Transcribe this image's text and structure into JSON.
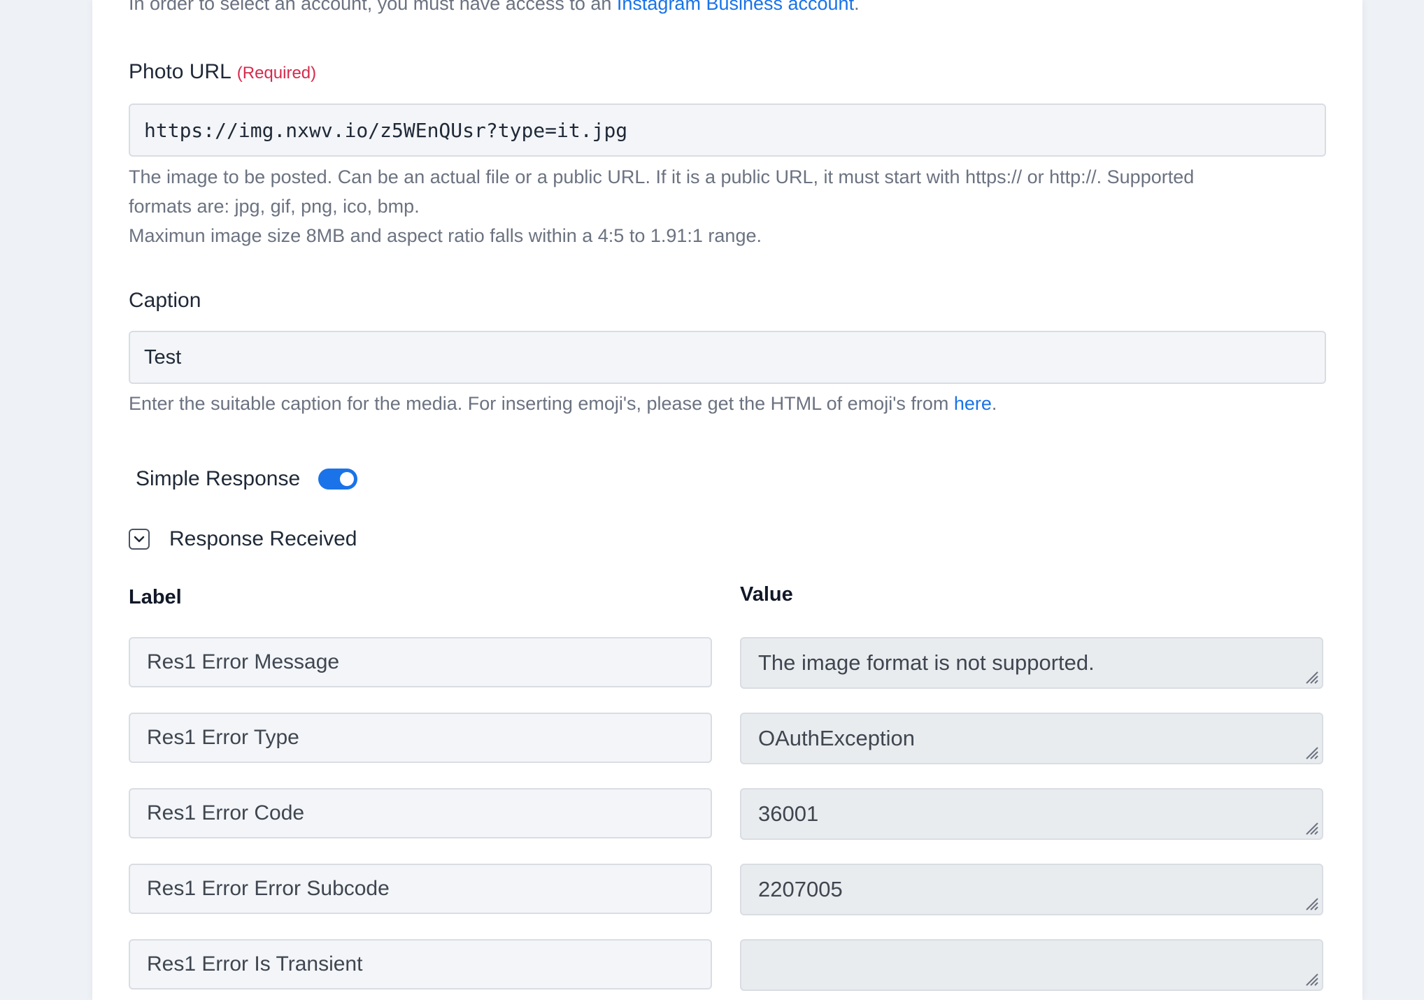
{
  "top_note": {
    "text": "In order to select an account, you must have access to an ",
    "link": "Instagram Business account",
    "suffix": "."
  },
  "photo_url": {
    "label": "Photo URL",
    "required": "(Required)",
    "value": "https://img.nxwv.io/z5WEnQUsr?type=it.jpg",
    "help_line1": "The image to be posted. Can be an actual file or a public URL. If it is a public URL, it must start with https:// or http://. Supported",
    "help_line2": "formats are: jpg, gif, png, ico, bmp.",
    "help_line3": "Maximun image size 8MB and aspect ratio falls within a 4:5 to 1.91:1 range."
  },
  "caption": {
    "label": "Caption",
    "value": "Test",
    "help_text": "Enter the suitable caption for the media. For inserting emoji's, please get the HTML of emoji's from ",
    "help_link": "here",
    "help_suffix": "."
  },
  "simple_response": {
    "label": "Simple Response",
    "enabled": true,
    "accent": "#1a73e8"
  },
  "response_received": {
    "label": "Response Received"
  },
  "table": {
    "label_header": "Label",
    "value_header": "Value",
    "rows": [
      {
        "label": "Res1 Error Message",
        "value": "The image format is not supported."
      },
      {
        "label": "Res1 Error Type",
        "value": "OAuthException"
      },
      {
        "label": "Res1 Error Code",
        "value": "36001"
      },
      {
        "label": "Res1 Error Error Subcode",
        "value": "2207005"
      },
      {
        "label": "Res1 Error Is Transient",
        "value": ""
      }
    ]
  }
}
